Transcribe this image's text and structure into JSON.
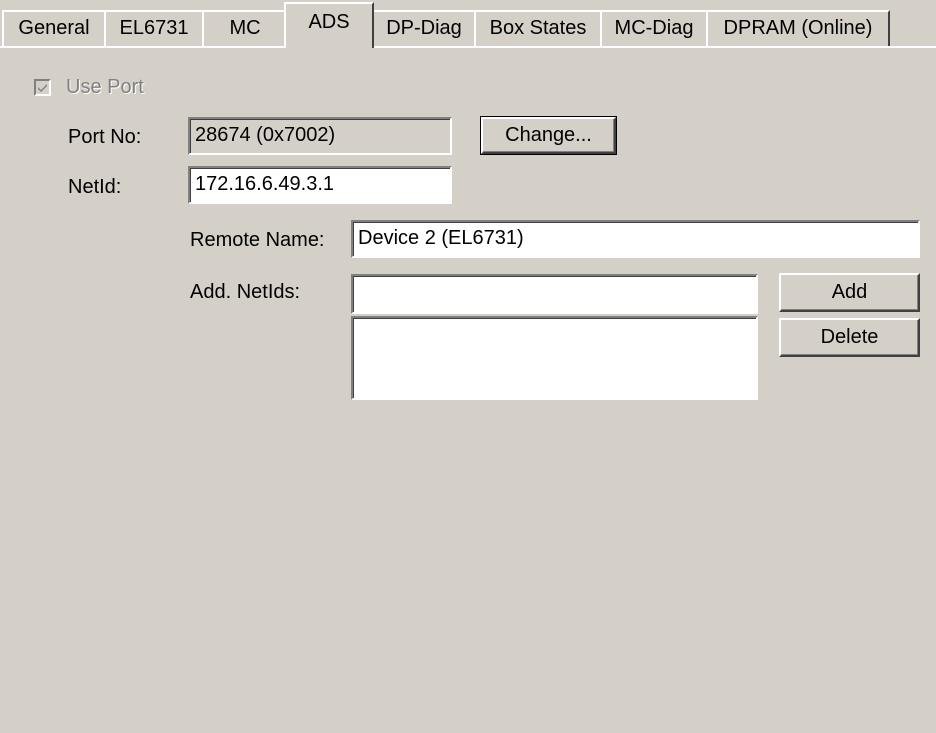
{
  "tabs": [
    {
      "label": "General",
      "active": false
    },
    {
      "label": "EL6731",
      "active": false
    },
    {
      "label": "MC",
      "active": false
    },
    {
      "label": "ADS",
      "active": true
    },
    {
      "label": "DP-Diag",
      "active": false
    },
    {
      "label": "Box States",
      "active": false
    },
    {
      "label": "MC-Diag",
      "active": false
    },
    {
      "label": "DPRAM (Online)",
      "active": false
    }
  ],
  "use_port": {
    "label": "Use Port",
    "checked": true,
    "disabled": true
  },
  "port": {
    "label": "Port No:",
    "value": "28674 (0x7002)",
    "change_button": "Change..."
  },
  "netid": {
    "label": "NetId:",
    "value": "172.16.6.49.3.1"
  },
  "remote_name": {
    "label": "Remote Name:",
    "value": "Device 2 (EL6731)"
  },
  "add_netids": {
    "label": "Add. NetIds:",
    "input_value": "",
    "list_items": [],
    "add_button": "Add",
    "delete_button": "Delete"
  },
  "colors": {
    "dialog_face": "#d4d0c8",
    "field_background": "#ffffff",
    "disabled_text": "#808080"
  }
}
